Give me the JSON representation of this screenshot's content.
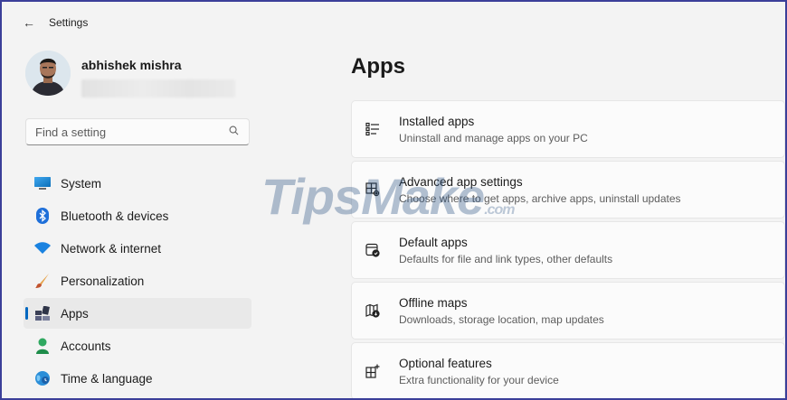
{
  "window": {
    "title": "Settings"
  },
  "profile": {
    "name": "abhishek mishra"
  },
  "search": {
    "placeholder": "Find a setting"
  },
  "sidebar": {
    "items": [
      {
        "label": "System",
        "icon": "system-icon"
      },
      {
        "label": "Bluetooth & devices",
        "icon": "bluetooth-icon"
      },
      {
        "label": "Network & internet",
        "icon": "wifi-icon"
      },
      {
        "label": "Personalization",
        "icon": "brush-icon"
      },
      {
        "label": "Apps",
        "icon": "apps-icon",
        "active": true
      },
      {
        "label": "Accounts",
        "icon": "person-icon"
      },
      {
        "label": "Time & language",
        "icon": "globe-clock-icon"
      }
    ]
  },
  "main": {
    "title": "Apps",
    "cards": [
      {
        "title": "Installed apps",
        "desc": "Uninstall and manage apps on your PC",
        "icon": "list-icon"
      },
      {
        "title": "Advanced app settings",
        "desc": "Choose where to get apps, archive apps, uninstall updates",
        "icon": "app-settings-icon"
      },
      {
        "title": "Default apps",
        "desc": "Defaults for file and link types, other defaults",
        "icon": "default-apps-icon"
      },
      {
        "title": "Offline maps",
        "desc": "Downloads, storage location, map updates",
        "icon": "map-icon"
      },
      {
        "title": "Optional features",
        "desc": "Extra functionality for your device",
        "icon": "optional-features-icon"
      }
    ]
  },
  "watermark": {
    "text": "TipsMake",
    "suffix": ".com"
  },
  "colors": {
    "accent": "#0067c0",
    "border": "#3b3f99"
  }
}
